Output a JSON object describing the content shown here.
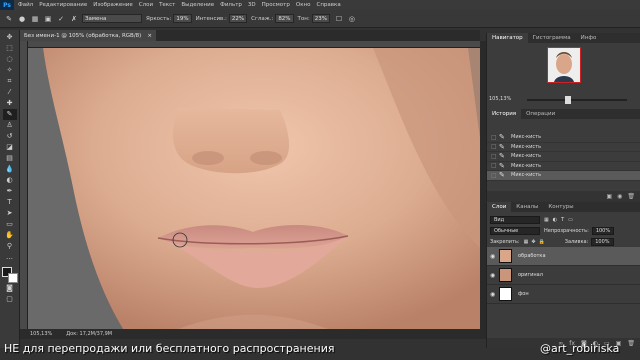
{
  "menubar": {
    "logo": "Ps",
    "items": [
      "Файл",
      "Редактирование",
      "Изображение",
      "Слои",
      "Текст",
      "Выделение",
      "Фильтр",
      "3D",
      "Просмотр",
      "Окно",
      "Справка"
    ]
  },
  "options": {
    "mode_value": "Замена",
    "brightness_label": "Яркость:",
    "brightness_value": "19%",
    "strength_label": "Интенсив.:",
    "strength_value": "22%",
    "smooth_label": "Сглаж.:",
    "smooth_value": "82%",
    "hue_label": "Тон:",
    "hue_value": "23%"
  },
  "document": {
    "tab_title": "Без имени-1 @ 105% (обработка, RGB/8)",
    "zoom": "105,13%",
    "doc_size": "Док: 17,2М/37,9М"
  },
  "navigator": {
    "tabs": [
      "Навигатор",
      "Гистограмма",
      "Инфо"
    ],
    "zoom": "105,13%"
  },
  "history": {
    "tabs": [
      "История",
      "Операции"
    ],
    "items": [
      "Микс-кисть",
      "Микс-кисть",
      "Микс-кисть",
      "Микс-кисть",
      "Микс-кисть"
    ]
  },
  "layers": {
    "tabs": [
      "Слои",
      "Каналы",
      "Контуры"
    ],
    "filter_value": "Вид",
    "blend_mode": "Обычные",
    "opacity_label": "Непрозрачность:",
    "opacity_value": "100%",
    "lock_label": "Закрепить:",
    "fill_label": "Заливка:",
    "fill_value": "100%",
    "items": [
      "обработка",
      "оригинал",
      "фон"
    ]
  },
  "watermark": {
    "text": "НЕ для перепродажи или бесплатного распространения",
    "author": "@art_robiriska"
  },
  "colors": {
    "ui_dark": "#323232",
    "skin": "#d9a68a",
    "selected_row": "#5a5a5a"
  }
}
